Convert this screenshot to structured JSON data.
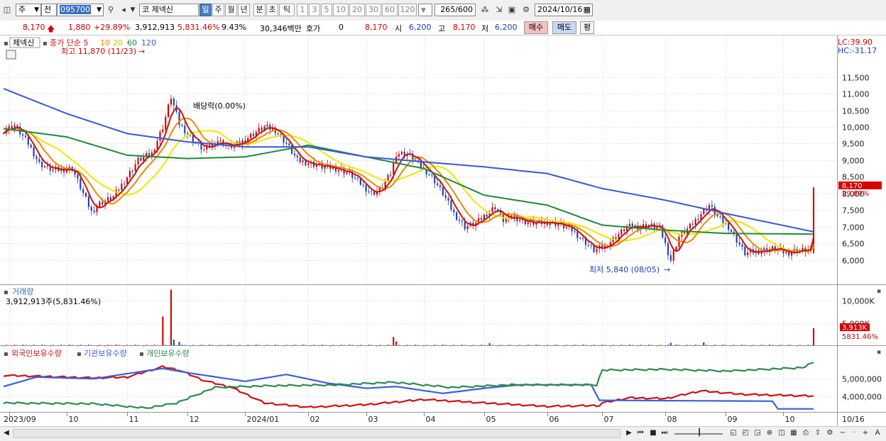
{
  "toolbar": {
    "mode": "주",
    "type": "전",
    "code": "095700",
    "market": "코",
    "name": "제넥신",
    "periods": [
      "일",
      "주",
      "월",
      "년",
      "분",
      "초",
      "틱"
    ],
    "period_selected": "일",
    "minutes": [
      "1",
      "3",
      "5",
      "10",
      "20",
      "30",
      "60",
      "120"
    ],
    "count": "265",
    "count_total": "/600",
    "date": "2024/10/16"
  },
  "quote": {
    "price": "8,170",
    "change": "1,880",
    "change_pct": "+29.89%",
    "volume": "3,912,913",
    "volume_pct": "5,831.46%",
    "turnover": "9.43%",
    "amount": "30,346백만",
    "hoga_label": "호가",
    "hoga_value": "0",
    "hoga_price": "8,170",
    "open_label": "시",
    "open": "6,200",
    "high_label": "고",
    "high": "8,170",
    "low_label": "저",
    "low": "6,200",
    "buy_label": "매수",
    "sell_label": "매도",
    "eval_label": "평"
  },
  "colors": {
    "up": "#d00000",
    "down": "#1a3fb0",
    "ma5": "#cc1111",
    "ma10": "#ee8800",
    "ma20": "#f2e600",
    "ma60": "#1e8a3a",
    "ma120": "#3a57d6",
    "foreign": "#d01010",
    "institution": "#3a5fe0",
    "individual": "#2e8b4e"
  },
  "chart_data": [
    {
      "type": "line",
      "title": "제넥신",
      "legend": [
        "종가 단순 5",
        "10",
        "20",
        "60",
        "120"
      ],
      "x_tick_labels": [
        "2023/09",
        "10",
        "11",
        "12",
        "2024/01",
        "02",
        "03",
        "04",
        "05",
        "06",
        "07",
        "08",
        "09",
        "10",
        "10/16"
      ],
      "y_tick_labels": [
        "11,500",
        "11,000",
        "10,500",
        "10,000",
        "9,500",
        "9,000",
        "8,500",
        "8,000",
        "7,500",
        "7,000",
        "6,500",
        "6,000"
      ],
      "ylim": [
        5400,
        12300
      ],
      "annotations": {
        "high": "최고 11,870 (11/23)",
        "low": "최저 5,840 (08/05)",
        "dividend": "배당락(0.00%)",
        "lc": "LC:39.90",
        "hc": "HC:-31.17",
        "last_price": "8,170",
        "last_pct": "29.89%"
      },
      "close_anchors": [
        [
          "2023-08-30",
          9900
        ],
        [
          "2023-09-05",
          10050
        ],
        [
          "2023-09-12",
          9500
        ],
        [
          "2023-09-18",
          8900
        ],
        [
          "2023-09-25",
          8700
        ],
        [
          "2023-10-04",
          8750
        ],
        [
          "2023-10-10",
          8000
        ],
        [
          "2023-10-13",
          7450
        ],
        [
          "2023-10-18",
          7700
        ],
        [
          "2023-10-25",
          7900
        ],
        [
          "2023-11-01",
          8500
        ],
        [
          "2023-11-07",
          9000
        ],
        [
          "2023-11-14",
          9200
        ],
        [
          "2023-11-20",
          10000
        ],
        [
          "2023-11-23",
          10900
        ],
        [
          "2023-11-28",
          10100
        ],
        [
          "2023-12-05",
          9600
        ],
        [
          "2023-12-11",
          9300
        ],
        [
          "2023-12-18",
          9600
        ],
        [
          "2023-12-22",
          9400
        ],
        [
          "2023-12-28",
          9500
        ],
        [
          "2024-01-04",
          9800
        ],
        [
          "2024-01-10",
          10000
        ],
        [
          "2024-01-16",
          9900
        ],
        [
          "2024-01-22",
          9500
        ],
        [
          "2024-01-26",
          9000
        ],
        [
          "2024-02-02",
          8900
        ],
        [
          "2024-02-08",
          8800
        ],
        [
          "2024-02-15",
          8750
        ],
        [
          "2024-02-22",
          8600
        ],
        [
          "2024-02-28",
          8300
        ],
        [
          "2024-03-05",
          8000
        ],
        [
          "2024-03-08",
          8100
        ],
        [
          "2024-03-14",
          8600
        ],
        [
          "2024-03-18",
          9200
        ],
        [
          "2024-03-22",
          9200
        ],
        [
          "2024-03-28",
          8900
        ],
        [
          "2024-04-04",
          8500
        ],
        [
          "2024-04-10",
          8000
        ],
        [
          "2024-04-16",
          7400
        ],
        [
          "2024-04-22",
          7000
        ],
        [
          "2024-04-26",
          7100
        ],
        [
          "2024-05-02",
          7400
        ],
        [
          "2024-05-07",
          7600
        ],
        [
          "2024-05-10",
          7200
        ],
        [
          "2024-05-16",
          7300
        ],
        [
          "2024-05-22",
          7150
        ],
        [
          "2024-05-28",
          7100
        ],
        [
          "2024-06-04",
          7150
        ],
        [
          "2024-06-10",
          7050
        ],
        [
          "2024-06-14",
          6900
        ],
        [
          "2024-06-20",
          6600
        ],
        [
          "2024-06-26",
          6300
        ],
        [
          "2024-07-02",
          6400
        ],
        [
          "2024-07-08",
          6700
        ],
        [
          "2024-07-12",
          7000
        ],
        [
          "2024-07-18",
          7000
        ],
        [
          "2024-07-24",
          7050
        ],
        [
          "2024-07-30",
          6950
        ],
        [
          "2024-08-05",
          6000
        ],
        [
          "2024-08-08",
          6700
        ],
        [
          "2024-08-14",
          7000
        ],
        [
          "2024-08-20",
          7400
        ],
        [
          "2024-08-23",
          7650
        ],
        [
          "2024-08-28",
          7300
        ],
        [
          "2024-09-03",
          7000
        ],
        [
          "2024-09-06",
          6600
        ],
        [
          "2024-09-11",
          6200
        ],
        [
          "2024-09-20",
          6300
        ],
        [
          "2024-09-26",
          6350
        ],
        [
          "2024-10-02",
          6200
        ],
        [
          "2024-10-08",
          6300
        ],
        [
          "2024-10-15",
          6290
        ],
        [
          "2024-10-16",
          8170
        ]
      ],
      "ma60_anchors": [
        [
          "2023-08-30",
          9950
        ],
        [
          "2023-10-01",
          9700
        ],
        [
          "2023-11-01",
          9150
        ],
        [
          "2023-12-01",
          9050
        ],
        [
          "2024-01-01",
          9100
        ],
        [
          "2024-02-01",
          9450
        ],
        [
          "2024-03-01",
          9100
        ],
        [
          "2024-04-01",
          8750
        ],
        [
          "2024-05-01",
          7950
        ],
        [
          "2024-06-01",
          7650
        ],
        [
          "2024-07-01",
          7050
        ],
        [
          "2024-08-01",
          6900
        ],
        [
          "2024-09-01",
          6800
        ],
        [
          "2024-10-16",
          6780
        ]
      ],
      "ma120_anchors": [
        [
          "2023-08-30",
          11150
        ],
        [
          "2023-10-01",
          10400
        ],
        [
          "2023-11-01",
          9800
        ],
        [
          "2023-12-01",
          9550
        ],
        [
          "2024-01-01",
          9400
        ],
        [
          "2024-02-01",
          9400
        ],
        [
          "2024-03-01",
          9100
        ],
        [
          "2024-04-01",
          8950
        ],
        [
          "2024-05-01",
          8800
        ],
        [
          "2024-06-01",
          8600
        ],
        [
          "2024-07-01",
          8150
        ],
        [
          "2024-08-01",
          7800
        ],
        [
          "2024-09-01",
          7400
        ],
        [
          "2024-10-16",
          6850
        ]
      ]
    },
    {
      "type": "bar",
      "title": "거래량",
      "subtitle": "3,912,913주(5,831.46%)",
      "y_tick_labels": [
        "10,000K",
        "5,000K"
      ],
      "last_volume": "3,913K",
      "last_volume_pct": "5831.46%",
      "ylim": [
        0,
        12500000
      ],
      "base_volume": 180000,
      "spikes": [
        [
          "2023-11-20",
          6500000
        ],
        [
          "2023-11-23",
          12400000
        ],
        [
          "2023-11-24",
          1400000
        ],
        [
          "2023-11-28",
          900000
        ],
        [
          "2024-03-15",
          2000000
        ],
        [
          "2024-03-18",
          1000000
        ],
        [
          "2024-05-03",
          600000
        ],
        [
          "2024-08-05",
          700000
        ],
        [
          "2024-08-21",
          800000
        ],
        [
          "2024-10-16",
          3912913
        ]
      ]
    },
    {
      "type": "line",
      "legend": [
        "외국인보유수량",
        "기관보유수량",
        "개인보유수량"
      ],
      "y_tick_labels": [
        "5,000,000",
        "4,000,000"
      ],
      "ylim": [
        3200000,
        6000000
      ],
      "series": [
        {
          "name": "외국인보유수량",
          "anchors": [
            [
              "2023-08-30",
              5200000
            ],
            [
              "2023-09-15",
              5150000
            ],
            [
              "2023-10-15",
              5050000
            ],
            [
              "2023-11-01",
              5100000
            ],
            [
              "2023-11-20",
              5700000
            ],
            [
              "2023-11-28",
              5500000
            ],
            [
              "2023-12-10",
              4900000
            ],
            [
              "2023-12-25",
              4500000
            ],
            [
              "2024-01-10",
              3600000
            ],
            [
              "2024-02-01",
              3350000
            ],
            [
              "2024-03-01",
              3500000
            ],
            [
              "2024-04-01",
              3800000
            ],
            [
              "2024-05-01",
              3600000
            ],
            [
              "2024-06-01",
              3400000
            ],
            [
              "2024-06-28",
              3450000
            ],
            [
              "2024-07-01",
              3600000
            ],
            [
              "2024-07-15",
              3900000
            ],
            [
              "2024-08-01",
              3850000
            ],
            [
              "2024-08-20",
              4300000
            ],
            [
              "2024-09-10",
              4100000
            ],
            [
              "2024-10-16",
              4000000
            ]
          ]
        },
        {
          "name": "기관보유수량",
          "anchors": [
            [
              "2023-08-30",
              4600000
            ],
            [
              "2023-09-15",
              5150000
            ],
            [
              "2023-10-15",
              5050000
            ],
            [
              "2023-11-01",
              5350000
            ],
            [
              "2023-11-20",
              5650000
            ],
            [
              "2023-12-01",
              5400000
            ],
            [
              "2024-01-01",
              4900000
            ],
            [
              "2024-01-20",
              5300000
            ],
            [
              "2024-02-10",
              4800000
            ],
            [
              "2024-03-01",
              4500000
            ],
            [
              "2024-03-18",
              4600000
            ],
            [
              "2024-04-10",
              4200000
            ],
            [
              "2024-05-01",
              4500000
            ],
            [
              "2024-05-20",
              4700000
            ],
            [
              "2024-06-25",
              4700000
            ],
            [
              "2024-06-28",
              3800000
            ],
            [
              "2024-09-25",
              3750000
            ],
            [
              "2024-09-27",
              3300000
            ],
            [
              "2024-10-16",
              3300000
            ]
          ]
        },
        {
          "name": "개인보유수량",
          "anchors": [
            [
              "2023-08-30",
              3600000
            ],
            [
              "2023-10-15",
              3550000
            ],
            [
              "2023-11-10",
              3300000
            ],
            [
              "2023-11-25",
              3600000
            ],
            [
              "2023-12-15",
              4500000
            ],
            [
              "2024-01-15",
              4600000
            ],
            [
              "2024-02-15",
              4650000
            ],
            [
              "2024-03-15",
              4800000
            ],
            [
              "2024-04-15",
              4500000
            ],
            [
              "2024-05-15",
              4650000
            ],
            [
              "2024-06-27",
              4650000
            ],
            [
              "2024-06-29",
              5500000
            ],
            [
              "2024-08-01",
              5550000
            ],
            [
              "2024-09-01",
              5450000
            ],
            [
              "2024-10-10",
              5650000
            ],
            [
              "2024-10-16",
              5950000
            ]
          ]
        }
      ]
    }
  ]
}
